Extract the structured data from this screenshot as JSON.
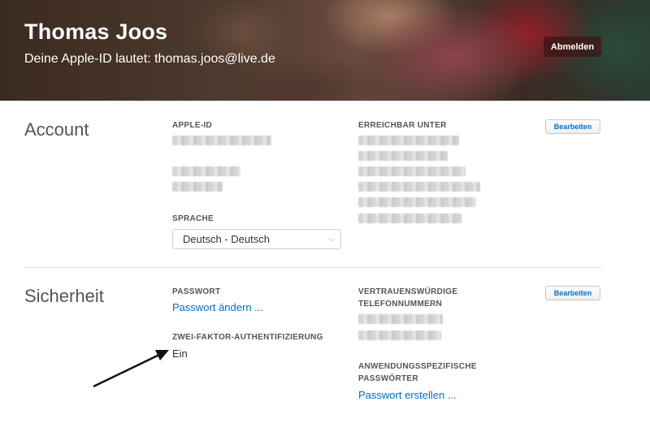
{
  "header": {
    "name": "Thomas Joos",
    "subtitle": "Deine Apple-ID lautet: thomas.joos@live.de",
    "logout_label": "Abmelden"
  },
  "account": {
    "title": "Account",
    "apple_id_label": "APPLE-ID",
    "reachable_label": "ERREICHBAR UNTER",
    "language_label": "SPRACHE",
    "language_value": "Deutsch - Deutsch",
    "edit_label": "Bearbeiten"
  },
  "security": {
    "title": "Sicherheit",
    "password_label": "PASSWORT",
    "change_password_link": "Passwort ändern ...",
    "two_factor_label": "ZWEI-FAKTOR-AUTHENTIFIZIERUNG",
    "two_factor_value": "Ein",
    "trusted_numbers_label": "VERTRAUENSWÜRDIGE TELEFONNUMMERN",
    "app_passwords_label": "ANWENDUNGSSPEZIFISCHE PASSWÖRTER",
    "create_password_link": "Passwort erstellen ...",
    "edit_label": "Bearbeiten"
  },
  "colors": {
    "link": "#0070c9",
    "annotation_arrow": "#111111"
  }
}
